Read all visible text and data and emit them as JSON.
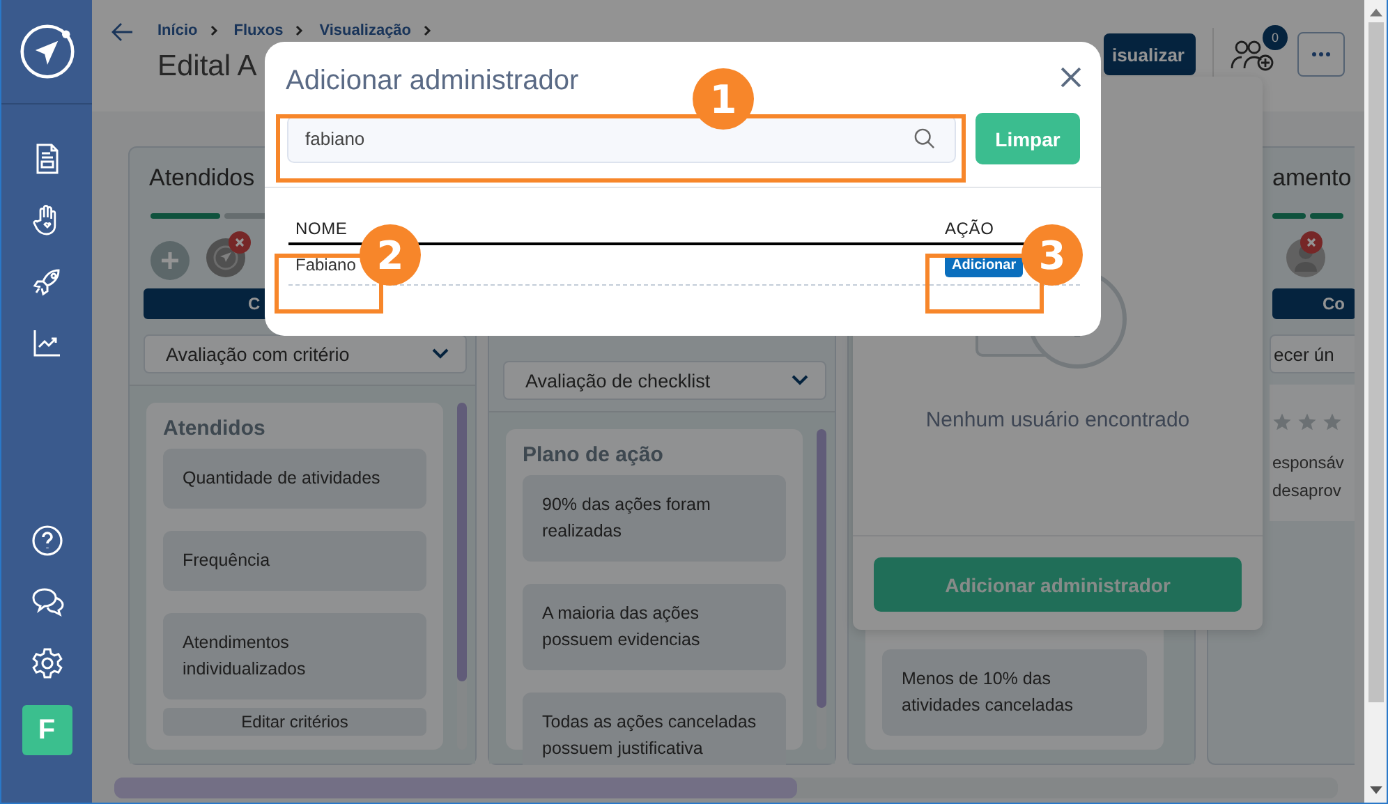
{
  "sidebar": {
    "avatar": "F"
  },
  "header": {
    "breadcrumb": [
      "Início",
      "Fluxos",
      "Visualização"
    ],
    "title": "Edital A",
    "view_button": "isualizar",
    "participants_count": "0"
  },
  "columns": [
    {
      "title": "Atendidos",
      "steps": [
        {
          "done": true
        },
        {
          "done": false
        }
      ],
      "button": "C",
      "dropdown": "Avaliação com critério",
      "card": {
        "title": "Atendidos",
        "items": [
          "Quantidade de atividades",
          "Frequência",
          "Atendimentos individualizados"
        ],
        "edit_button": "Editar critérios"
      }
    },
    {
      "dropdown": "Avaliação de checklist",
      "card": {
        "title": "Plano de ação",
        "items": [
          "90% das ações foram realizadas",
          "A maioria das ações possuem evidencias",
          "Todas as ações canceladas possuem justificativa"
        ]
      }
    },
    {
      "card": {
        "items": [
          "Menos de 10% das atividades canceladas"
        ]
      }
    },
    {
      "title": "amento",
      "steps": [
        {
          "done": true
        },
        {
          "done": true
        }
      ],
      "button": "Co",
      "dropdown": "ecer ún",
      "lines": [
        "esponsáv",
        "desaprov"
      ]
    }
  ],
  "side_panel": {
    "empty_message": "Nenhum usuário encontrado",
    "button": "Adicionar administrador"
  },
  "modal": {
    "title": "Adicionar administrador",
    "search": {
      "value": "fabiano"
    },
    "clear_button": "Limpar",
    "table": {
      "columns": [
        "NOME",
        "AÇÃO"
      ],
      "rows": [
        {
          "name": "Fabiano",
          "action": "Adicionar"
        }
      ]
    }
  },
  "callouts": [
    "1",
    "2",
    "3"
  ]
}
